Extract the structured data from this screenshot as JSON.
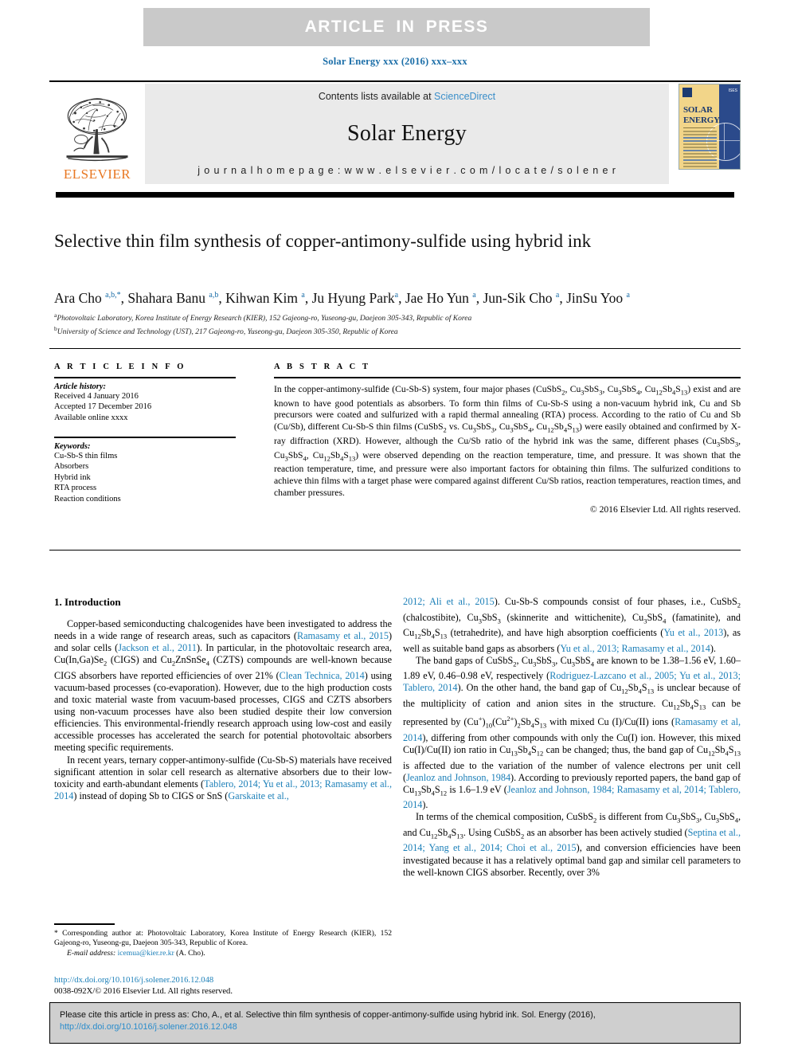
{
  "banner": {
    "text": "ARTICLE  IN  PRESS"
  },
  "running_head": {
    "text": "Solar Energy xxx (2016) xxx–xxx"
  },
  "masthead": {
    "contents_prefix": "Contents lists available at ",
    "sciencedirect": "ScienceDirect",
    "journal_name": "Solar Energy",
    "homepage": "j o u r n a l   h o m e p a g e :   w w w . e l s e v i e r . c o m / l o c a t e / s o l e n e r",
    "publisher": "ELSEVIER",
    "cover": {
      "title_line1": "SOLAR",
      "title_line2": "ENERGY",
      "society": "ISES"
    }
  },
  "article": {
    "title": "Selective thin film synthesis of copper-antimony-sulfide using hybrid ink",
    "authors_html": "Ara Cho <sup>a,b,</sup><sup>*</sup>, Shahara Banu <sup>a,b</sup>, Kihwan Kim <sup>a</sup>, Ju Hyung Park<sup>a</sup>, Jae Ho Yun <sup>a</sup>, Jun-Sik Cho <sup>a</sup>, JinSu Yoo <sup>a</sup>",
    "affiliations": [
      "Photovoltaic Laboratory, Korea Institute of Energy Research (KIER), 152 Gajeong-ro, Yuseong-gu, Daejeon 305-343, Republic of Korea",
      "University of Science and Technology (UST), 217 Gajeong-ro, Yuseong-gu, Daejeon 305-350, Republic of Korea"
    ],
    "affiliation_marks": [
      "a",
      "b"
    ]
  },
  "article_info": {
    "heading": "A R T I C L E   I N F O",
    "history_label": "Article history:",
    "history": [
      "Received 4 January 2016",
      "Accepted 17 December 2016",
      "Available online xxxx"
    ],
    "keywords_label": "Keywords:",
    "keywords": [
      "Cu-Sb-S thin films",
      "Absorbers",
      "Hybrid ink",
      "RTA process",
      "Reaction conditions"
    ]
  },
  "abstract": {
    "heading": "A B S T R A C T",
    "body_html": "In the copper-antimony-sulfide (Cu-Sb-S) system, four major phases (CuSbS<sub>2</sub>, Cu<sub>3</sub>SbS<sub>3</sub>, Cu<sub>3</sub>SbS<sub>4</sub>, Cu<sub>12</sub>Sb<sub>4</sub>S<sub>13</sub>) exist and are known to have good potentials as absorbers. To form thin films of Cu-Sb-S using a non-vacuum hybrid ink, Cu and Sb precursors were coated and sulfurized with a rapid thermal annealing (RTA) process. According to the ratio of Cu and Sb (Cu/Sb), different Cu-Sb-S thin films (CuSbS<sub>2</sub> vs. Cu<sub>3</sub>SbS<sub>3</sub>, Cu<sub>3</sub>SbS<sub>4</sub>, Cu<sub>12</sub>Sb<sub>4</sub>S<sub>13</sub>) were easily obtained and confirmed by X-ray diffraction (XRD). However, although the Cu/Sb ratio of the hybrid ink was the same, different phases (Cu<sub>3</sub>SbS<sub>3</sub>, Cu<sub>3</sub>SbS<sub>4</sub>, Cu<sub>12</sub>Sb<sub>4</sub>S<sub>13</sub>) were observed depending on the reaction temperature, time, and pressure. It was shown that the reaction temperature, time, and pressure were also important factors for obtaining thin films. The sulfurized conditions to achieve thin films with a target phase were compared against different Cu/Sb ratios, reaction temperatures, reaction times, and chamber pressures.",
    "copyright": "© 2016 Elsevier Ltd. All rights reserved."
  },
  "body": {
    "section_heading": "1. Introduction",
    "left_paragraphs_html": [
      "Copper-based semiconducting chalcogenides have been investigated to address the needs in a wide range of research areas, such as capacitors (<span class=\"ref\">Ramasamy et al., 2015</span>) and solar cells (<span class=\"ref\">Jackson et al., 2011</span>). In particular, in the photovoltaic research area, Cu(In,Ga)Se<sub>2</sub> (CIGS) and Cu<sub>2</sub>ZnSnSe<sub>4</sub> (CZTS) compounds are well-known because CIGS absorbers have reported efficiencies of over 21% (<span class=\"ref\">Clean Technica, 2014</span>) using vacuum-based processes (co-evaporation). However, due to the high production costs and toxic material waste from vacuum-based processes, CIGS and CZTS absorbers using non-vacuum processes have also been studied despite their low conversion efficiencies. This environmental-friendly research approach using low-cost and easily accessible processes has accelerated the search for potential photovoltaic absorbers meeting specific requirements.",
      "In recent years, ternary copper-antimony-sulfide (Cu-Sb-S) materials have received significant attention in solar cell research as alternative absorbers due to their low-toxicity and earth-abundant elements (<span class=\"ref\">Tablero, 2014; Yu et al., 2013; Ramasamy et al., 2014</span>) instead of doping Sb to CIGS or SnS (<span class=\"ref\">Garskaite et al.,</span>"
    ],
    "right_paragraphs_html": [
      "<span class=\"ref\">2012; Ali et al., 2015</span>). Cu-Sb-S compounds consist of four phases, i.e., CuSbS<sub>2</sub> (chalcostibite), Cu<sub>3</sub>SbS<sub>3</sub> (skinnerite and wittichenite), Cu<sub>3</sub>SbS<sub>4</sub> (famatinite), and Cu<sub>12</sub>Sb<sub>4</sub>S<sub>13</sub> (tetrahedrite), and have high absorption coefficients (<span class=\"ref\">Yu et al., 2013</span>), as well as suitable band gaps as absorbers (<span class=\"ref\">Yu et al., 2013; Ramasamy et al., 2014</span>).",
      "The band gaps of CuSbS<sub>2</sub>, Cu<sub>3</sub>SbS<sub>3</sub>, Cu<sub>3</sub>SbS<sub>4</sub> are known to be 1.38–1.56 eV, 1.60–1.89 eV, 0.46–0.98 eV, respectively (<span class=\"ref\">Rodriguez-Lazcano et al., 2005; Yu et al., 2013; Tablero, 2014</span>). On the other hand, the band gap of Cu<sub>12</sub>Sb<sub>4</sub>S<sub>13</sub> is unclear because of the multiplicity of cation and anion sites in the structure. Cu<sub>12</sub>Sb<sub>4</sub>S<sub>13</sub> can be represented by (Cu<sup>+</sup>)<sub>10</sub>(Cu<sup>2+</sup>)<sub>2</sub>Sb<sub>4</sub>S<sub>13</sub> with mixed Cu (I)/Cu(II) ions (<span class=\"ref\">Ramasamy et al, 2014</span>), differing from other compounds with only the Cu(I) ion. However, this mixed Cu(I)/Cu(II) ion ratio in Cu<sub>13</sub>Sb<sub>4</sub>S<sub>12</sub> can be changed; thus, the band gap of Cu<sub>12</sub>Sb<sub>4</sub>S<sub>13</sub> is affected due to the variation of the number of valence electrons per unit cell (<span class=\"ref\">Jeanloz and Johnson, 1984</span>). According to previously reported papers, the band gap of Cu<sub>13</sub>Sb<sub>4</sub>S<sub>12</sub> is 1.6–1.9 eV (<span class=\"ref\">Jeanloz and Johnson, 1984; Ramasamy et al, 2014; Tablero, 2014</span>).",
      "In terms of the chemical composition, CuSbS<sub>2</sub> is different from Cu<sub>3</sub>SbS<sub>3</sub>, Cu<sub>3</sub>SbS<sub>4</sub>, and Cu<sub>12</sub>Sb<sub>4</sub>S<sub>13</sub>. Using CuSbS<sub>2</sub> as an absorber has been actively studied (<span class=\"ref\">Septina et al., 2014; Yang et al., 2014; Choi et al., 2015</span>), and conversion efficiencies have been investigated because it has a relatively optimal band gap and similar cell parameters to the well-known CIGS absorber. Recently, over 3%"
    ]
  },
  "footnote": {
    "corresponding_html": "* Corresponding author at: Photovoltaic Laboratory, Korea Institute of Energy Research (KIER), 152 Gajeong-ro, Yuseong-gu, Daejeon 305-343, Republic of Korea.",
    "email_label": "E-mail address:",
    "email": "icemua@kier.re.kr",
    "email_suffix": "(A. Cho)."
  },
  "doi_block": {
    "doi_url": "http://dx.doi.org/10.1016/j.solener.2016.12.048",
    "issn_line": "0038-092X/© 2016 Elsevier Ltd. All rights reserved."
  },
  "cite_box": {
    "text_prefix": "Please cite this article in press as: Cho, A., et al. Selective thin film synthesis of copper-antimony-sulfide using hybrid ink. Sol. Energy (2016), ",
    "link": "http://dx.doi.org/10.1016/j.solener.2016.12.048"
  },
  "colors": {
    "link": "#1b7fb8",
    "running_head": "#1b6ea8",
    "elsevier_orange": "#E87722",
    "banner_bg": "#c9c9c9",
    "masthead_bg": "#eaeaea",
    "cite_box_bg": "#cfcfcf"
  }
}
